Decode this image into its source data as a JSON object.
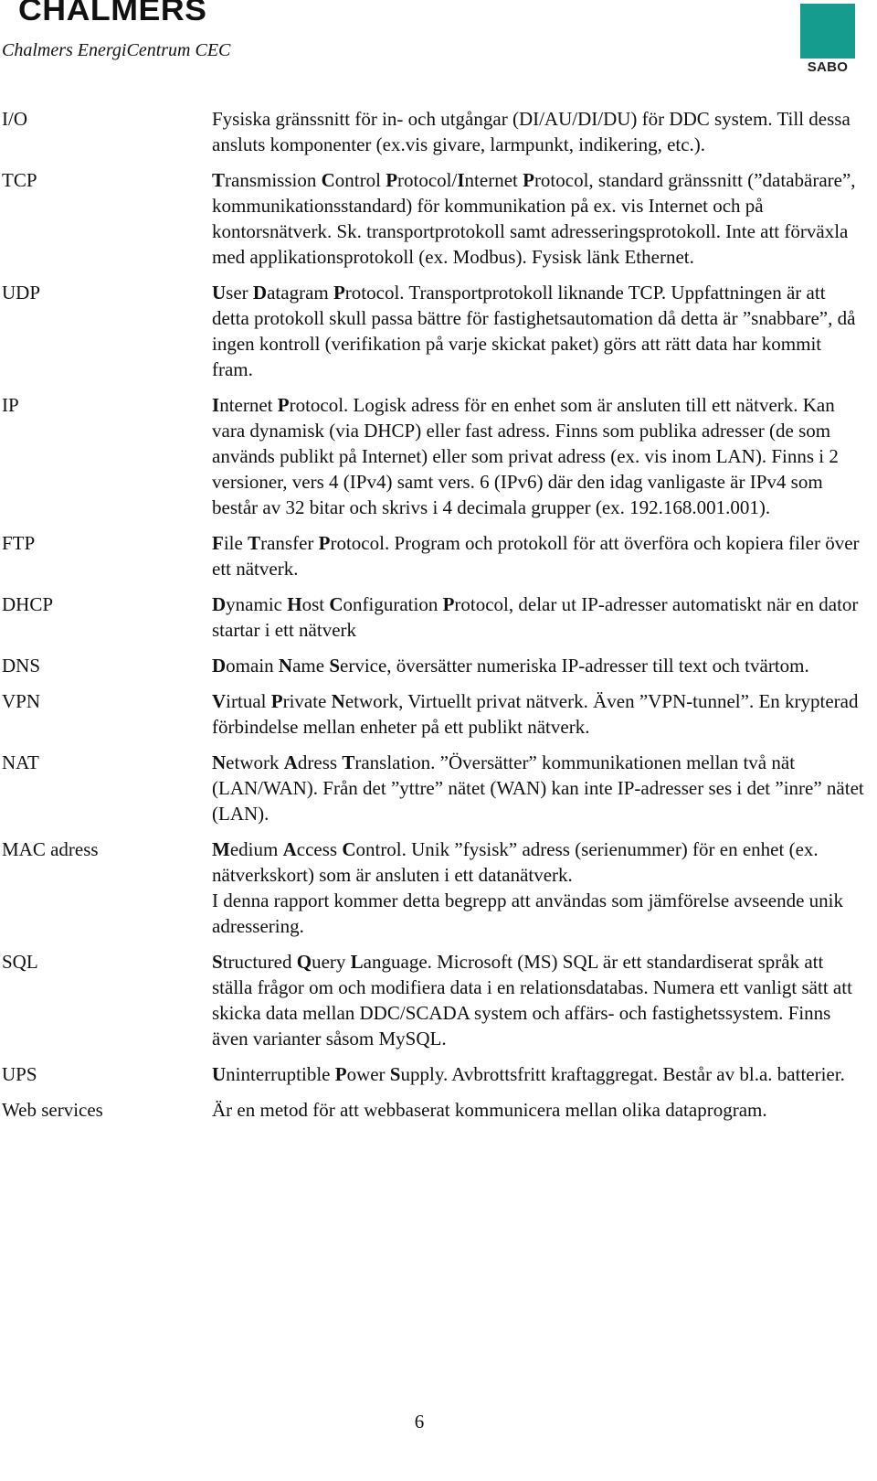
{
  "header": {
    "logo_left": "CHALMERS",
    "logo_left_subtitle": "Chalmers EnergiCentrum CEC",
    "logo_right": "SABO",
    "logo_right_color": "#169c8e"
  },
  "glossary": [
    {
      "term": "I/O",
      "definition": "Fysiska gränssnitt för in- och utgångar (DI/AU/DI/DU) för DDC system. Till dessa ansluts komponenter (ex.vis givare, larmpunkt, indikering, etc.).",
      "bold_initials": []
    },
    {
      "term": "TCP",
      "definition": "Transmission Control Protocol/Internet Protocol, standard gränssnitt (”databärare”, kommunikationsstandard) för kommunikation på ex. vis Internet och på kontorsnätverk. Sk. transportprotokoll samt adresseringsprotokoll. Inte att förväxla med applikationsprotokoll (ex. Modbus). Fysisk länk Ethernet.",
      "bold_initials": [
        "Transmission",
        "Control",
        "Protocol",
        "Internet",
        "Protocol,"
      ]
    },
    {
      "term": "UDP",
      "definition": "User Datagram Protocol. Transportprotokoll liknande TCP. Uppfattningen är att detta protokoll skull passa bättre för fastighetsautomation då detta är ”snabbare”, då ingen kontroll (verifikation på varje skickat paket) görs att rätt data har kommit fram.",
      "bold_initials": [
        "User",
        "Datagram",
        "Protocol."
      ]
    },
    {
      "term": "IP",
      "definition": "Internet Protocol. Logisk adress för en enhet som är ansluten till ett nätverk. Kan vara dynamisk (via DHCP) eller fast adress. Finns som publika adresser (de som används publikt på Internet) eller som privat adress (ex. vis inom LAN). Finns i 2 versioner, vers 4 (IPv4) samt vers. 6 (IPv6) där den idag vanligaste är IPv4 som består av 32 bitar och skrivs i 4 decimala grupper (ex. 192.168.001.001).",
      "bold_initials": [
        "Internet",
        "Protocol."
      ]
    },
    {
      "term": "FTP",
      "definition": "File Transfer Protocol. Program och protokoll för att överföra och kopiera filer över ett nätverk.",
      "bold_initials": [
        "File",
        "Transfer",
        "Protocol."
      ]
    },
    {
      "term": "DHCP",
      "definition": "Dynamic Host Configuration Protocol, delar ut IP-adresser automatiskt när en dator startar i ett nätverk",
      "bold_initials": [
        "Dynamic",
        "Host",
        "Configuration",
        "Protocol,"
      ]
    },
    {
      "term": "DNS",
      "definition": "Domain Name Service, översätter numeriska IP-adresser till text och tvärtom.",
      "bold_initials": [
        "Domain",
        "Name",
        "Service,"
      ]
    },
    {
      "term": "VPN",
      "definition": "Virtual Private Network, Virtuellt privat nätverk. Även ”VPN-tunnel”. En krypterad förbindelse mellan enheter på ett publikt nätverk.",
      "bold_initials": [
        "Virtual",
        "Private",
        "Network,"
      ]
    },
    {
      "term": "NAT",
      "definition": "Network Adress Translation. ”Översätter” kommunikationen mellan två nät (LAN/WAN). Från det ”yttre” nätet (WAN) kan inte IP-adresser ses i det ”inre” nätet (LAN).",
      "bold_initials": [
        "Network",
        "Adress",
        "Translation."
      ]
    },
    {
      "term": "MAC adress",
      "definition": "Medium Access Control. Unik ”fysisk” adress (serienummer) för en enhet (ex. nätverkskort) som är ansluten i ett datanätverk.\nI denna rapport kommer detta begrepp att användas som jämförelse avseende unik adressering.",
      "bold_initials": [
        "Medium",
        "Access",
        "Control."
      ]
    },
    {
      "term": "SQL",
      "definition": "Structured Query Language. Microsoft (MS) SQL är ett standardiserat språk att ställa frågor om och modifiera data i en relationsdatabas. Numera ett vanligt sätt att skicka data mellan DDC/SCADA system och affärs- och fastighetssystem. Finns även varianter såsom MySQL.",
      "bold_initials": [
        "Structured",
        "Query",
        "Language."
      ]
    },
    {
      "term": "UPS",
      "definition": "Uninterruptible Power Supply. Avbrottsfritt kraftaggregat. Består av bl.a. batterier.",
      "bold_initials": [
        "Uninterruptible",
        "Power",
        "Supply."
      ]
    },
    {
      "term": "Web services",
      "definition": "Är en metod för att webbaserat kommunicera mellan olika dataprogram.",
      "bold_initials": []
    }
  ],
  "footer": {
    "page_number": "6"
  }
}
